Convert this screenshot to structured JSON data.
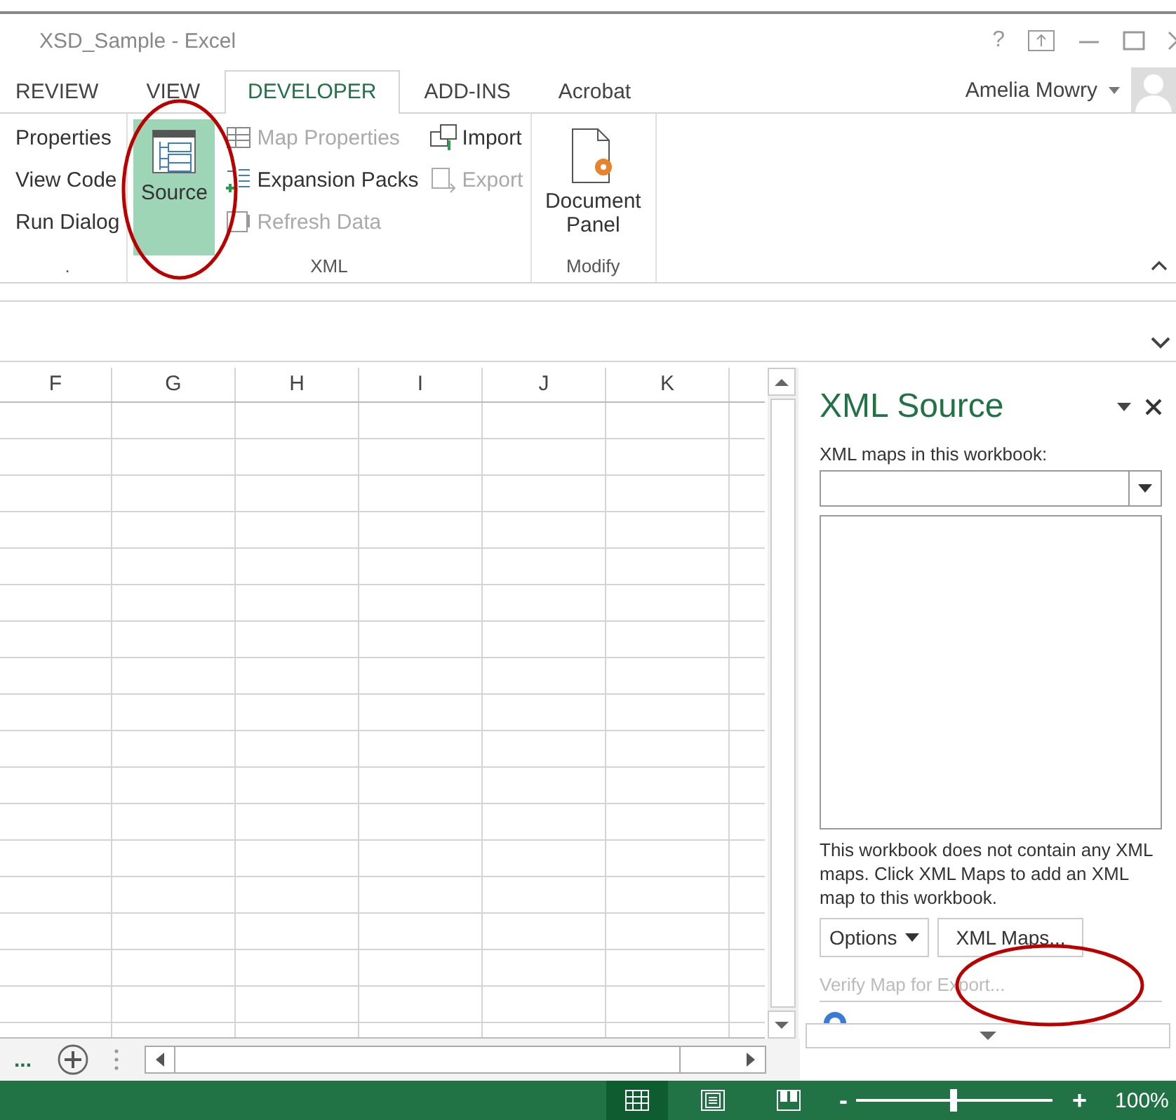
{
  "window": {
    "title": "XSD_Sample - Excel",
    "controls": [
      "?"
    ]
  },
  "tabs": [
    {
      "label": "REVIEW",
      "selected": false
    },
    {
      "label": "VIEW",
      "selected": false
    },
    {
      "label": "DEVELOPER",
      "selected": true
    },
    {
      "label": "ADD-INS",
      "selected": false
    },
    {
      "label": "Acrobat",
      "selected": false
    }
  ],
  "user": {
    "name": "Amelia Mowry"
  },
  "ribbon": {
    "groups": [
      {
        "label": ".",
        "items": [
          {
            "kind": "small",
            "label": "Properties",
            "disabled": false
          },
          {
            "kind": "small",
            "label": "View Code",
            "disabled": false
          },
          {
            "kind": "small",
            "label": "Run Dialog",
            "disabled": false
          }
        ]
      },
      {
        "label": "XML",
        "items": [
          {
            "kind": "large",
            "label": "Source",
            "disabled": false,
            "selected": true
          },
          {
            "kind": "small",
            "label": "Map Properties",
            "disabled": true
          },
          {
            "kind": "small",
            "label": "Expansion Packs",
            "disabled": false
          },
          {
            "kind": "small",
            "label": "Refresh Data",
            "disabled": true
          },
          {
            "kind": "small",
            "label": "Import",
            "disabled": false
          },
          {
            "kind": "small",
            "label": "Export",
            "disabled": true
          }
        ]
      },
      {
        "label": "Modify",
        "items": [
          {
            "kind": "large",
            "label": "Document Panel",
            "disabled": false,
            "selected": false
          }
        ]
      }
    ]
  },
  "sheet": {
    "columns": [
      "F",
      "G",
      "H",
      "I",
      "J",
      "K"
    ],
    "tabs_overflow": "..."
  },
  "xml_source": {
    "title": "XML Source",
    "maps_label": "XML maps in this workbook:",
    "message": "This workbook does not contain any XML maps. Click XML Maps to add an XML map to this workbook.",
    "options_button": "Options",
    "xml_maps_button": "XML Maps...",
    "verify_link": {
      "label": "Verify Map for Export...",
      "disabled": true
    }
  },
  "status_bar": {
    "views": [
      {
        "selected": true
      },
      {
        "selected": false
      },
      {
        "selected": false
      }
    ],
    "zoom": {
      "minus": "-",
      "plus": "+",
      "level": 0.5,
      "reading": "100%"
    }
  }
}
